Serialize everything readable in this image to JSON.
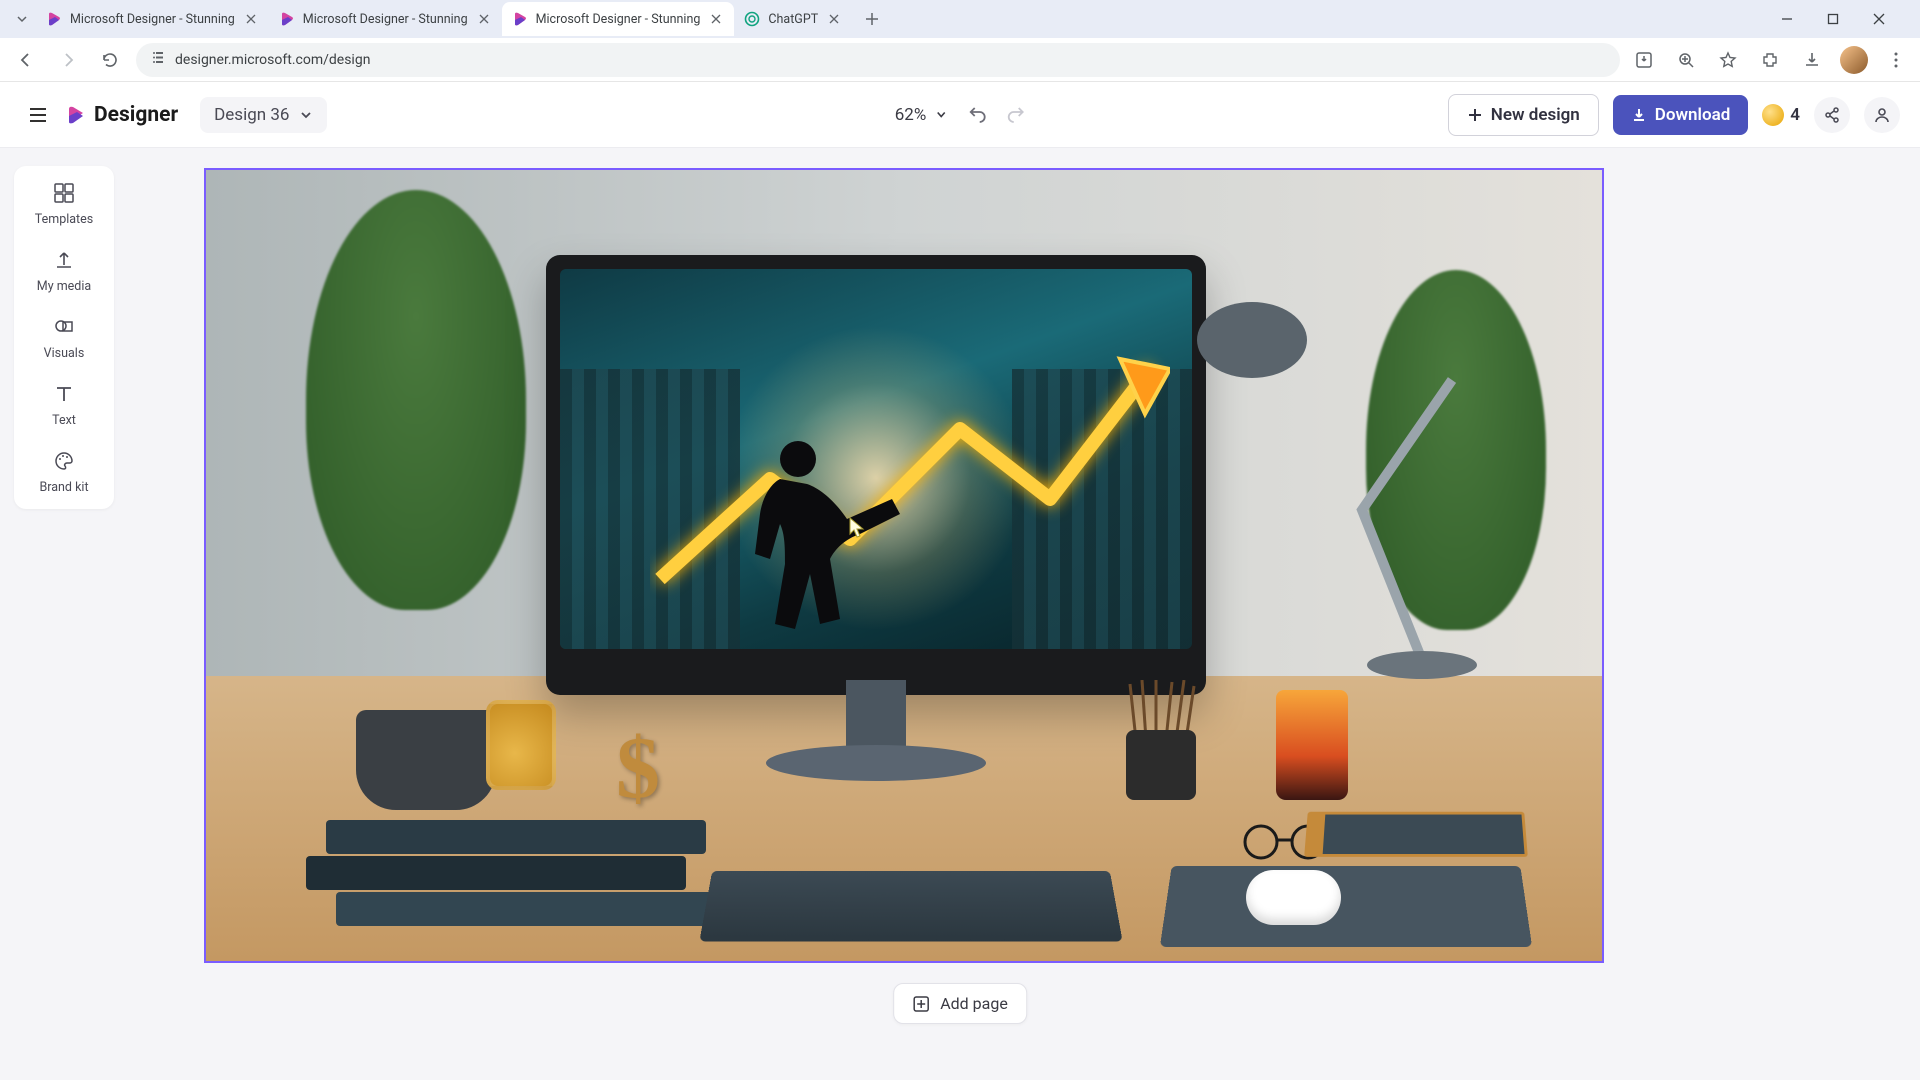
{
  "browser": {
    "tabs": [
      {
        "title": "Microsoft Designer - Stunning",
        "active": false,
        "type": "designer"
      },
      {
        "title": "Microsoft Designer - Stunning",
        "active": false,
        "type": "designer"
      },
      {
        "title": "Microsoft Designer - Stunning",
        "active": true,
        "type": "designer"
      },
      {
        "title": "ChatGPT",
        "active": false,
        "type": "chatgpt"
      }
    ],
    "url": "designer.microsoft.com/design"
  },
  "app": {
    "brand": "Designer",
    "design_name": "Design 36",
    "zoom": "62%",
    "new_design_label": "New design",
    "download_label": "Download",
    "credits": "4"
  },
  "rail": {
    "items": [
      {
        "id": "templates",
        "label": "Templates"
      },
      {
        "id": "my-media",
        "label": "My media"
      },
      {
        "id": "visuals",
        "label": "Visuals"
      },
      {
        "id": "text",
        "label": "Text"
      },
      {
        "id": "brand-kit",
        "label": "Brand kit"
      }
    ]
  },
  "canvas": {
    "add_page_label": "Add page"
  },
  "colors": {
    "primary": "#4b53bc",
    "selection": "#7a5cff"
  }
}
